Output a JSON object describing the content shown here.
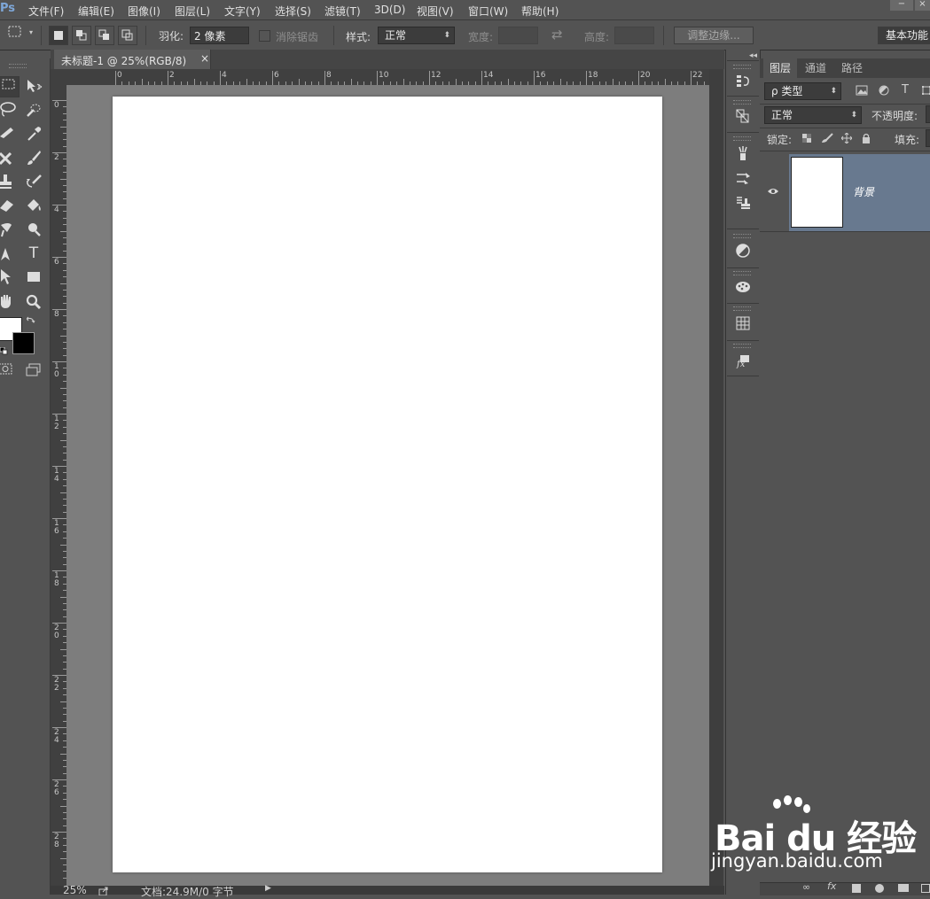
{
  "app": {
    "logo": "Ps"
  },
  "menu": [
    "文件(F)",
    "编辑(E)",
    "图像(I)",
    "图层(L)",
    "文字(Y)",
    "选择(S)",
    "滤镜(T)",
    "3D(D)",
    "视图(V)",
    "窗口(W)",
    "帮助(H)"
  ],
  "window": {
    "minimize": "−",
    "close": "×"
  },
  "options": {
    "feather_label": "羽化:",
    "feather_value": "2 像素",
    "antialias_label": "消除锯齿",
    "style_label": "样式:",
    "style_value": "正常",
    "width_label": "宽度:",
    "height_label": "高度:",
    "swap_glyph": "⇄",
    "refine_edge_label": "调整边缘...",
    "workspace_label": "基本功能"
  },
  "document": {
    "tab_title": "未标题-1 @ 25%(RGB/8)",
    "close_glyph": "×",
    "zoom": "25%",
    "doc_info": "文档:24.9M/0 字节",
    "ruler_h_labels": [
      "0",
      "2",
      "4",
      "6",
      "8",
      "10",
      "12",
      "14",
      "16",
      "18",
      "20",
      "22"
    ],
    "ruler_v_labels": [
      "0",
      "2",
      "4",
      "6",
      "8",
      "10",
      "12",
      "14",
      "16",
      "18",
      "20",
      "22",
      "24",
      "26",
      "28"
    ]
  },
  "tools": {
    "type_glyph": "T"
  },
  "layers_panel": {
    "tabs": [
      "图层",
      "通道",
      "路径"
    ],
    "filter_kind": "ρ 类型",
    "blend_mode": "正常",
    "opacity_label": "不透明度:",
    "lock_label": "锁定:",
    "fill_label": "填充:",
    "layer_name": "背景"
  },
  "panel_strip": {
    "collapse_glyph": "◂◂"
  },
  "watermark": {
    "logo": "Bai du 经验",
    "url": "jingyan.baidu.com"
  },
  "colors": {
    "background": "#535353",
    "canvas": "#ffffff",
    "canvas_area": "#7d7d7d",
    "selected_layer": "#68798f",
    "foreground_swatch": "#ffffff",
    "background_swatch": "#000000"
  }
}
